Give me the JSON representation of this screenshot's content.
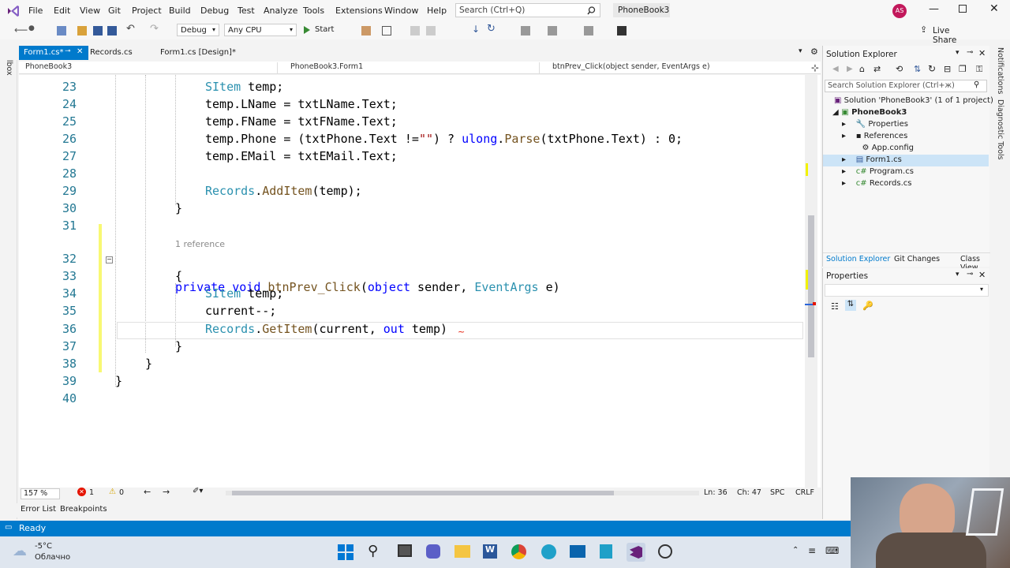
{
  "menubar": {
    "items": [
      "File",
      "Edit",
      "View",
      "Git",
      "Project",
      "Build",
      "Debug",
      "Test",
      "Analyze",
      "Tools",
      "Extensions",
      "Window",
      "Help"
    ],
    "search_placeholder": "Search (Ctrl+Q)",
    "solution_name": "PhoneBook3",
    "avatar_initials": "AS"
  },
  "toolbar": {
    "config": "Debug",
    "platform": "Any CPU",
    "start_label": "Start",
    "live_share": "Live Share"
  },
  "tabs": [
    {
      "label": "Form1.cs*",
      "active": true
    },
    {
      "label": "Records.cs",
      "active": false
    },
    {
      "label": "Form1.cs [Design]*",
      "active": false
    }
  ],
  "navbar": {
    "project": "PhoneBook3",
    "class": "PhoneBook3.Form1",
    "member": "btnPrev_Click(object sender, EventArgs e)"
  },
  "code": {
    "codelens": "1 reference",
    "lines": [
      {
        "n": "23",
        "text": "SItem temp;"
      },
      {
        "n": "24",
        "text": "temp.LName = txtLName.Text;"
      },
      {
        "n": "25",
        "text": "temp.FName = txtFName.Text;"
      },
      {
        "n": "26",
        "text": "temp.Phone = (txtPhone.Text !=\"\") ? ulong.Parse(txtPhone.Text) : 0;"
      },
      {
        "n": "27",
        "text": "temp.EMail = txtEMail.Text;"
      },
      {
        "n": "28",
        "text": ""
      },
      {
        "n": "29",
        "text": "Records.AddItem(temp);"
      },
      {
        "n": "30",
        "text": "}"
      },
      {
        "n": "31",
        "text": ""
      },
      {
        "n": "32",
        "text": "private void btnPrev_Click(object sender, EventArgs e)"
      },
      {
        "n": "33",
        "text": "{"
      },
      {
        "n": "34",
        "text": "SItem temp;"
      },
      {
        "n": "35",
        "text": "current--;"
      },
      {
        "n": "36",
        "text": "Records.GetItem(current, out temp)"
      },
      {
        "n": "37",
        "text": "}"
      },
      {
        "n": "38",
        "text": "}"
      },
      {
        "n": "39",
        "text": "}"
      },
      {
        "n": "40",
        "text": ""
      }
    ]
  },
  "editor_status": {
    "zoom": "157 %",
    "errors": "1",
    "warnings": "0",
    "ln": "Ln: 36",
    "ch": "Ch: 47",
    "spc": "SPC",
    "crlf": "CRLF"
  },
  "bottom_tabs": [
    "Error List",
    "Breakpoints"
  ],
  "status": {
    "text": "Ready"
  },
  "solution_explorer": {
    "title": "Solution Explorer",
    "search_placeholder": "Search Solution Explorer (Ctrl+ж)",
    "solution": "Solution 'PhoneBook3' (1 of 1 project)",
    "project": "PhoneBook3",
    "items": [
      "Properties",
      "References",
      "App.config",
      "Form1.cs",
      "Program.cs",
      "Records.cs"
    ],
    "selected": "Form1.cs",
    "tabs": [
      "Solution Explorer",
      "Git Changes",
      "Class View"
    ]
  },
  "properties": {
    "title": "Properties"
  },
  "side_left": {
    "toolbox": "Toolbox"
  },
  "side_right": {
    "notifications": "Notifications",
    "diagnostic": "Diagnostic Tools"
  },
  "taskbar": {
    "temp": "-5°C",
    "weather": "Облачно"
  },
  "colors": {
    "accent": "#007acc",
    "vs_purple": "#68217a",
    "error_red": "#e51400"
  }
}
